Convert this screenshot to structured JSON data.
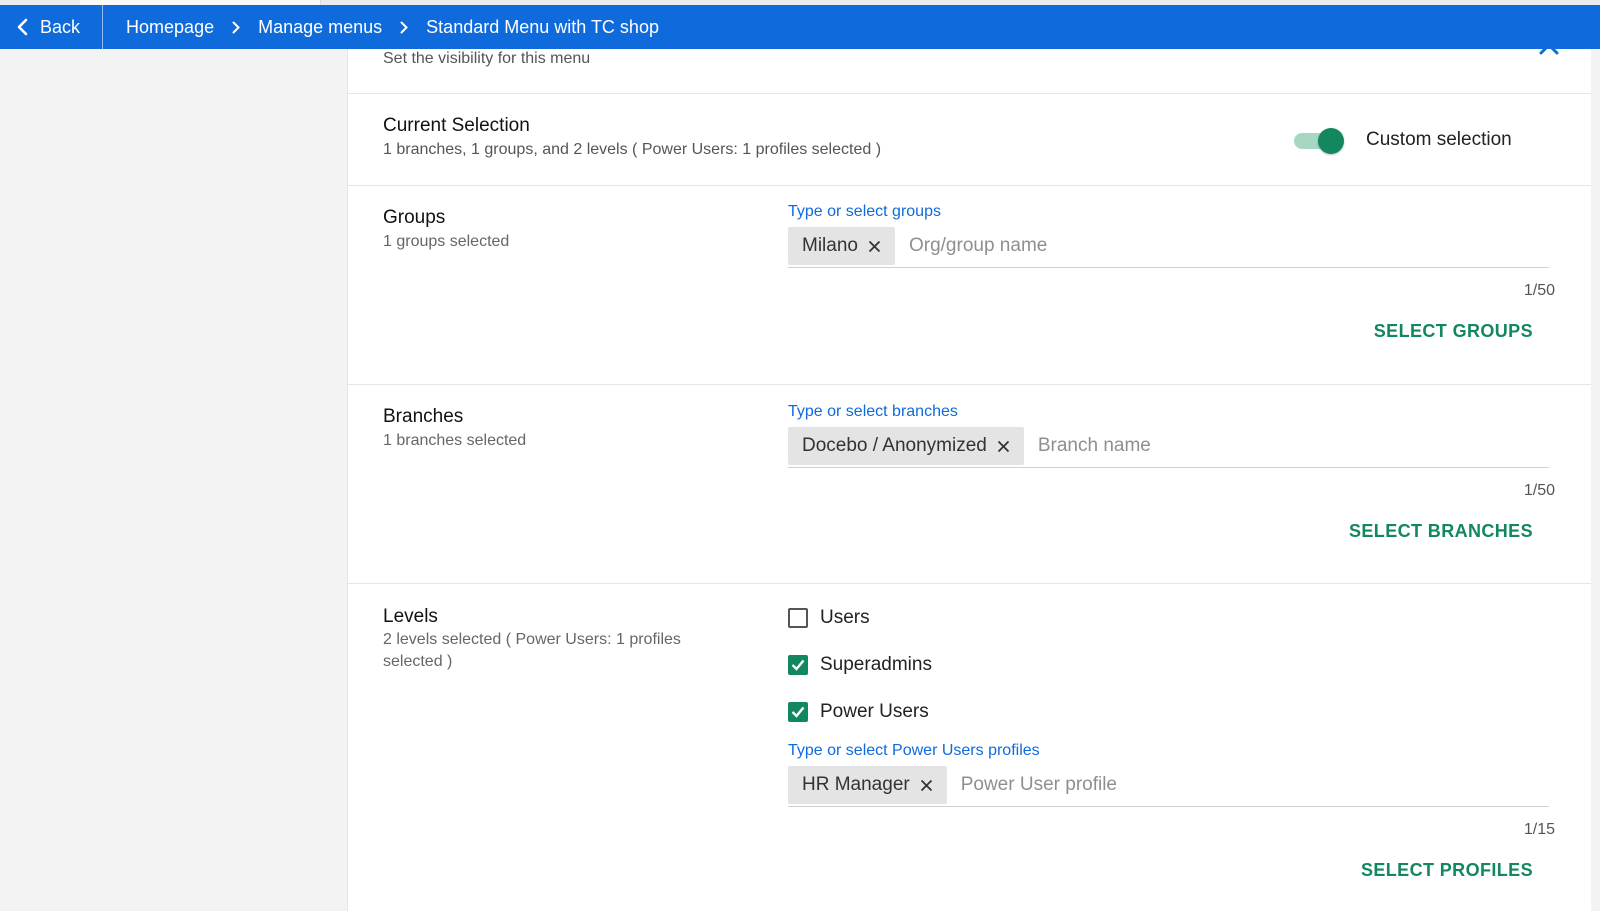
{
  "navbar": {
    "back_label": "Back",
    "breadcrumbs": [
      "Homepage",
      "Manage menus",
      "Standard Menu with TC shop"
    ]
  },
  "panel": {
    "subtitle": "Set the visibility for this menu",
    "current_selection": {
      "title": "Current Selection",
      "summary": "1 branches, 1 groups, and 2 levels ( Power Users: 1 profiles selected )",
      "toggle_label": "Custom selection",
      "toggle_on": true
    },
    "groups": {
      "title": "Groups",
      "subtitle": "1 groups selected",
      "field_label": "Type or select groups",
      "chip": "Milano",
      "placeholder": "Org/group name",
      "counter": "1/50",
      "action": "SELECT GROUPS"
    },
    "branches": {
      "title": "Branches",
      "subtitle": "1 branches selected",
      "field_label": "Type or select branches",
      "chip": "Docebo / Anonymized",
      "placeholder": "Branch name",
      "counter": "1/50",
      "action": "SELECT BRANCHES"
    },
    "levels": {
      "title": "Levels",
      "subtitle": "2 levels selected ( Power Users: 1 profiles selected )",
      "options": [
        {
          "label": "Users",
          "checked": false
        },
        {
          "label": "Superadmins",
          "checked": true
        },
        {
          "label": "Power Users",
          "checked": true
        }
      ],
      "field_label": "Type or select Power Users profiles",
      "chip": "HR Manager",
      "placeholder": "Power User profile",
      "counter": "1/15",
      "action": "SELECT PROFILES"
    }
  },
  "colors": {
    "navbar": "#0f6bdc",
    "accent_green": "#13875e",
    "toggle_track": "#a7d7c2",
    "field_label": "#0f6bdc"
  }
}
